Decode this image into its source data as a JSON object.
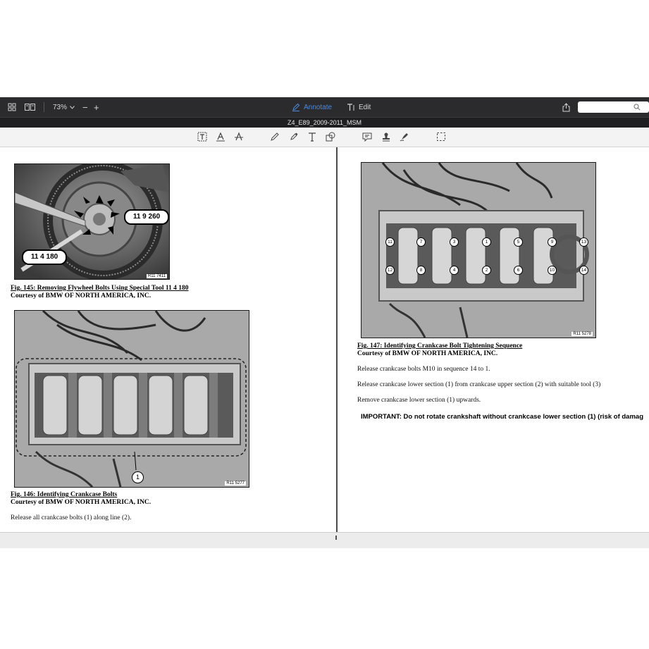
{
  "toolbar": {
    "zoom": "73%",
    "zoom_out": "−",
    "zoom_in": "+",
    "annotate_label": "Annotate",
    "edit_label": "Edit",
    "accent": "#4a8be0"
  },
  "document": {
    "title": "Z4_E89_2009-2011_MSM"
  },
  "left_page": {
    "fig145": {
      "callout_a": "11 9 260",
      "callout_b": "11 4 180",
      "ref": "R11 7411",
      "caption": "Fig. 145: Removing Flywheel Bolts Using Special Tool 11 4 180",
      "courtesy": "Courtesy of BMW OF NORTH AMERICA, INC."
    },
    "fig146": {
      "callout": "1",
      "ref": "R11 5277",
      "caption": "Fig. 146: Identifying Crankcase Bolts",
      "courtesy": "Courtesy of BMW OF NORTH AMERICA, INC."
    },
    "body1": "Release all crankcase bolts (1) along line (2)."
  },
  "right_page": {
    "fig147": {
      "ref": "R11 5278",
      "bolt_numbers": [
        "11",
        "7",
        "3",
        "1",
        "5",
        "9",
        "13",
        "12",
        "8",
        "4",
        "2",
        "6",
        "10",
        "14"
      ],
      "caption": "Fig. 147: Identifying Crankcase Bolt Tightening Sequence",
      "courtesy": "Courtesy of BMW OF NORTH AMERICA, INC."
    },
    "body1": "Release crankcase bolts M10 in sequence 14 to 1.",
    "body2": "Release crankcase lower section (1) from crankcase upper section (2) with suitable tool (3)",
    "body3": "Remove crankcase lower section (1) upwards.",
    "important": "IMPORTANT:  Do not rotate crankshaft without crankcase lower section (1) (risk of damag"
  }
}
